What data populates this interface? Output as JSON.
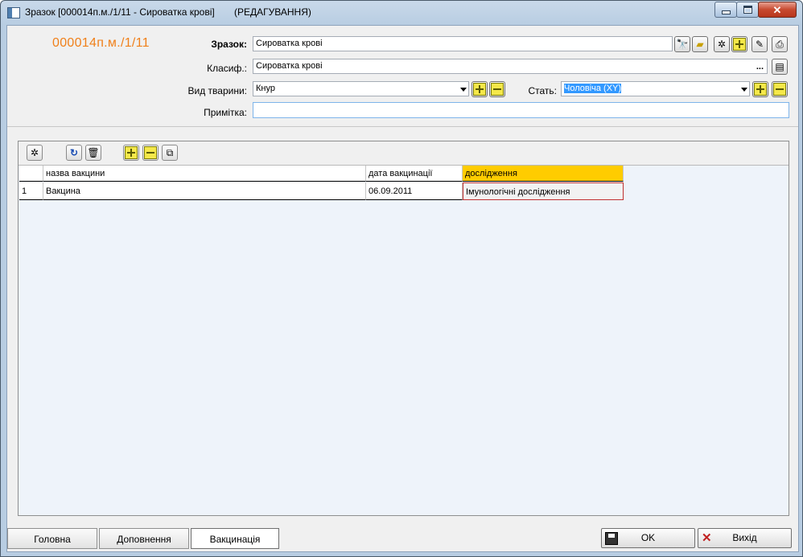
{
  "window": {
    "title": "Зразок [000014п.м./1/11 - Сироватка крові]",
    "mode": "(РЕДАГУВАННЯ)"
  },
  "header": {
    "sample_code": "000014п.м./1/11",
    "sample": {
      "label": "Зразок:",
      "value": "Сироватка крові"
    },
    "classifier": {
      "label": "Класиф.:",
      "value": "Сироватка крові",
      "ellipsis": "..."
    },
    "animal_type": {
      "label": "Вид тварини:",
      "value": "Кнур"
    },
    "sex": {
      "label": "Стать:",
      "value": "Чоловіча (XY)"
    },
    "note": {
      "label": "Примітка:",
      "value": ""
    }
  },
  "grid": {
    "columns": [
      "",
      "назва вакцини",
      "дата вакцинації",
      "дослідження"
    ],
    "rows": [
      {
        "num": "1",
        "vaccine": "Вакцина",
        "date": "06.09.2011",
        "research": "Імунологічні дослідження"
      }
    ],
    "active_header_color": "#ffcc00"
  },
  "tabs": [
    {
      "label": "Головна"
    },
    {
      "label": "Доповнення"
    },
    {
      "label": "Вакцинація"
    }
  ],
  "actions": {
    "ok": "OK",
    "exit": "Вихід"
  }
}
